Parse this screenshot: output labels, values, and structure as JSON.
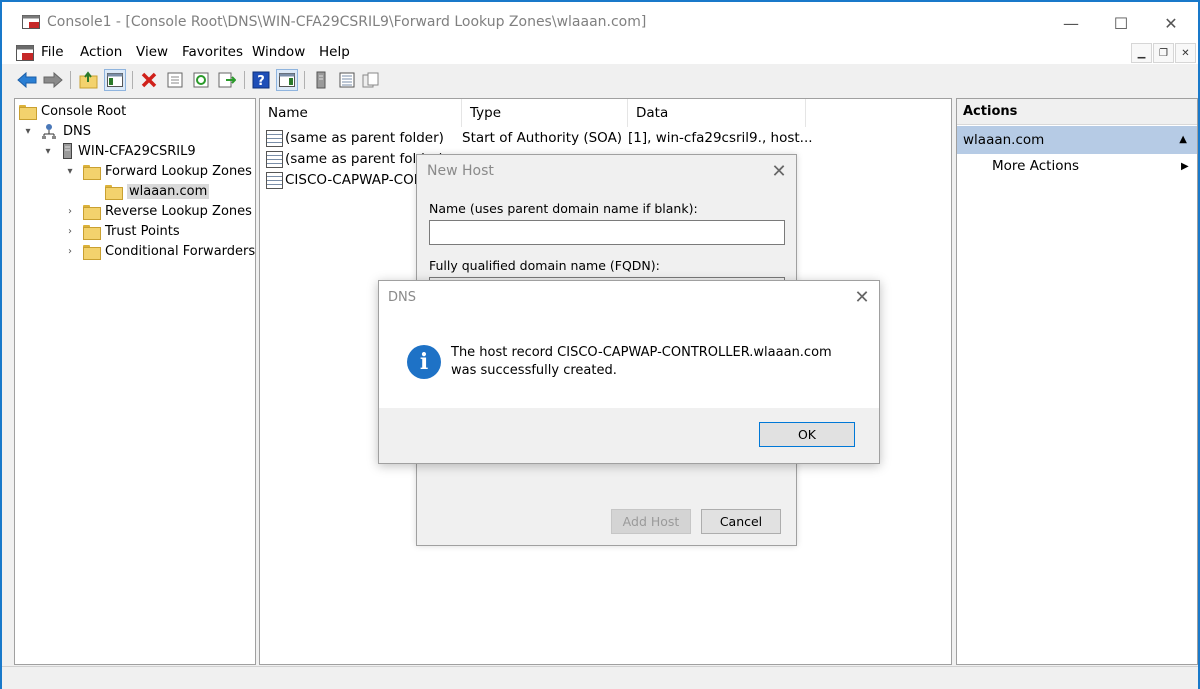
{
  "window": {
    "title": "Console1 - [Console Root\\DNS\\WIN-CFA29CSRIL9\\Forward Lookup Zones\\wlaaan.com]",
    "minimize_glyph": "—",
    "maximize_glyph": "☐",
    "close_glyph": "✕"
  },
  "menu": {
    "items": [
      "File",
      "Action",
      "View",
      "Favorites",
      "Window",
      "Help"
    ]
  },
  "tree": {
    "items": [
      {
        "label": "Console Root"
      },
      {
        "label": "DNS"
      },
      {
        "label": "WIN-CFA29CSRIL9"
      },
      {
        "label": "Forward Lookup Zones"
      },
      {
        "label": "wlaaan.com"
      },
      {
        "label": "Reverse Lookup Zones"
      },
      {
        "label": "Trust Points"
      },
      {
        "label": "Conditional Forwarders"
      }
    ]
  },
  "list": {
    "columns": [
      "Name",
      "Type",
      "Data"
    ],
    "rows": [
      {
        "name": "(same as parent folder)",
        "type": "Start of Authority (SOA)",
        "data": "[1], win-cfa29csril9., host..."
      },
      {
        "name": "(same as parent folder)",
        "type": "",
        "data": ""
      },
      {
        "name": "CISCO-CAPWAP-CON",
        "type": "",
        "data": ""
      }
    ]
  },
  "actions": {
    "header": "Actions",
    "selected": "wlaaan.com",
    "sub_item": "More Actions"
  },
  "new_host": {
    "title": "New Host",
    "name_label": "Name (uses parent domain name if blank):",
    "name_value": "",
    "fqdn_label": "Fully qualified domain name (FQDN):",
    "add_host": "Add Host",
    "cancel": "Cancel"
  },
  "msgbox": {
    "title": "DNS",
    "message": "The host record CISCO-CAPWAP-CONTROLLER.wlaaan.com was successfully created.",
    "ok": "OK",
    "icon": "info-icon"
  },
  "colors": {
    "window_border": "#1979ca",
    "selection": "#b6cbe5",
    "info_icon": "#1e72c6"
  }
}
